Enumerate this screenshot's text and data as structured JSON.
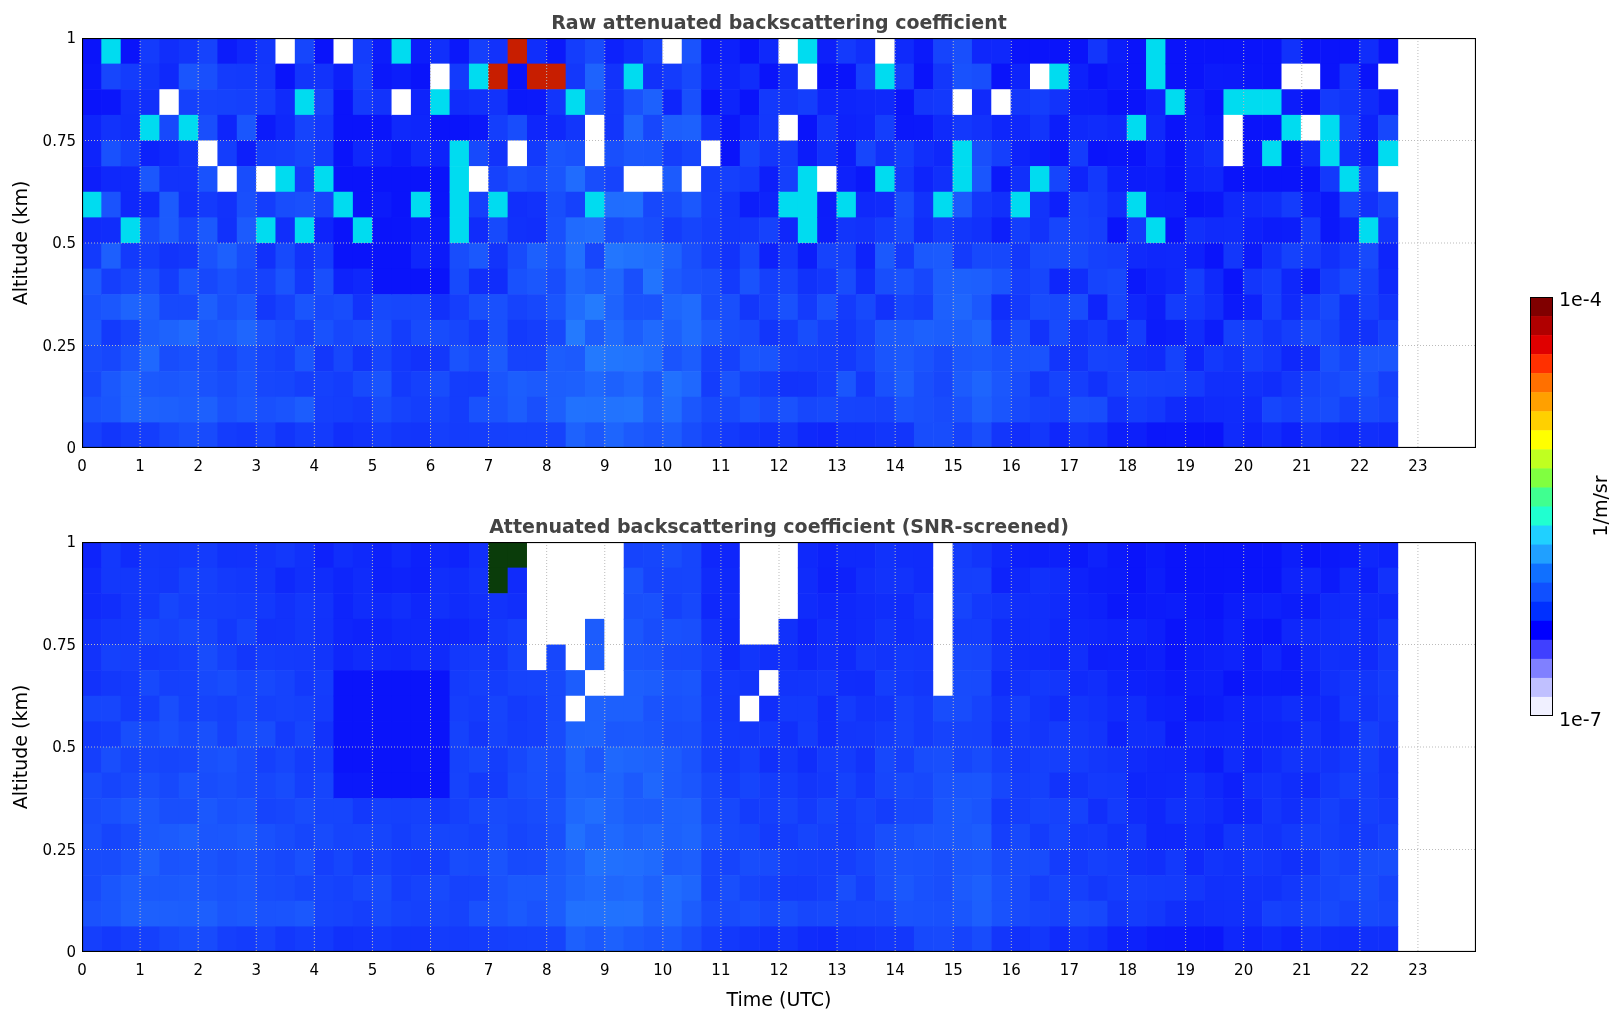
{
  "panels": [
    {
      "title": "Raw attenuated backscattering coefficient",
      "ylabel": "Altitude (km)",
      "kind": "raw",
      "yticks": [
        "1",
        "0.75",
        "0.5",
        "0.25",
        "0"
      ],
      "xticks": [
        "0",
        "1",
        "2",
        "3",
        "4",
        "5",
        "6",
        "7",
        "8",
        "9",
        "10",
        "11",
        "12",
        "13",
        "14",
        "15",
        "16",
        "17",
        "18",
        "19",
        "20",
        "21",
        "22",
        "23"
      ]
    },
    {
      "title": "Attenuated backscattering coefficient (SNR-screened)",
      "ylabel": "Altitude (km)",
      "kind": "screened",
      "yticks": [
        "1",
        "0.75",
        "0.5",
        "0.25",
        "0"
      ],
      "xticks": [
        "0",
        "1",
        "2",
        "3",
        "4",
        "5",
        "6",
        "7",
        "8",
        "9",
        "10",
        "11",
        "12",
        "13",
        "14",
        "15",
        "16",
        "17",
        "18",
        "19",
        "20",
        "21",
        "22",
        "23"
      ]
    }
  ],
  "xlabel": "Time (UTC)",
  "colorbar": {
    "max_label": "1e-4",
    "min_label": "1e-7",
    "unit": "1/m/sr"
  }
}
